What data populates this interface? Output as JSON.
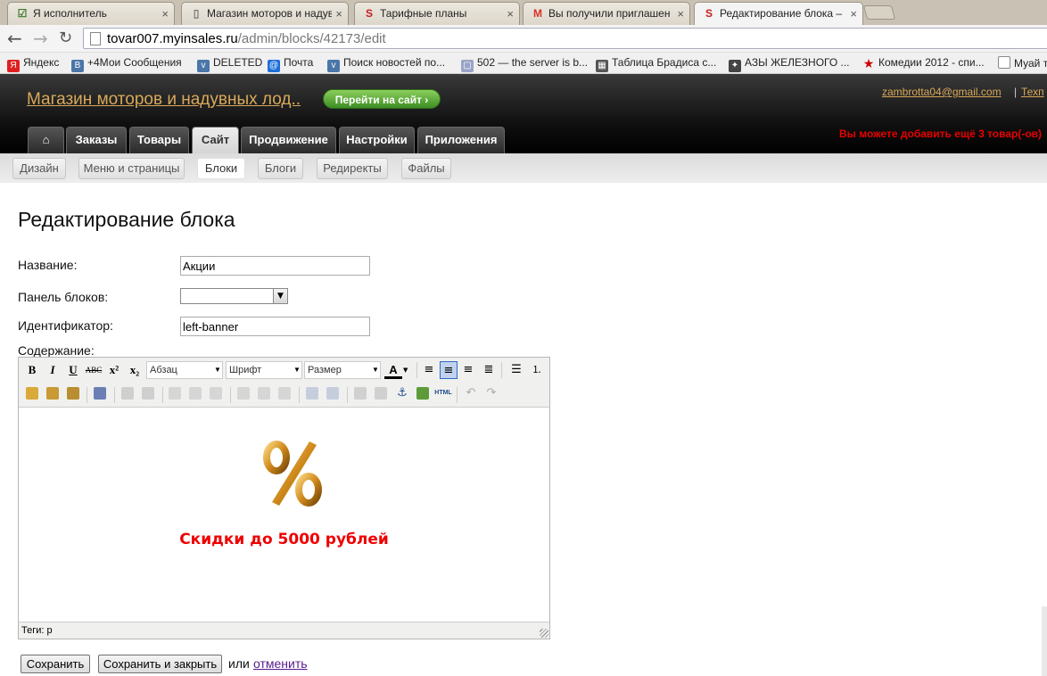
{
  "browser": {
    "tabs": [
      {
        "label": "Я исполнитель",
        "icon": "checkbox-favicon"
      },
      {
        "label": "Магазин моторов и надув",
        "icon": "page-favicon"
      },
      {
        "label": "Тарифные планы",
        "icon": "insales-favicon"
      },
      {
        "label": "Вы получили приглашен",
        "icon": "gmail-favicon"
      },
      {
        "label": "Редактирование блока –",
        "icon": "insales-favicon"
      }
    ],
    "url_host": "tovar007.myinsales.ru",
    "url_path": "/admin/blocks/42173/edit",
    "bookmarks": [
      {
        "label": "Яндекс",
        "color": "#e02020"
      },
      {
        "label": "+4Мои Сообщения",
        "color": "#4a76a8"
      },
      {
        "label": "DELETED",
        "color": "#4a76a8"
      },
      {
        "label": "Почта",
        "color": "#1e6fd9"
      },
      {
        "label": "Поиск новостей по...",
        "color": "#4a76a8"
      },
      {
        "label": "502 — the server is b...",
        "color": "#9aa4c8"
      },
      {
        "label": "Таблица Брадиса с...",
        "color": "#555555"
      },
      {
        "label": "АЗЫ ЖЕЛЕЗНОГО ...",
        "color": "#444444"
      },
      {
        "label": "Комедии 2012 - спи...",
        "color": "#cc0000"
      },
      {
        "label": "Муай т",
        "color": "#888888"
      }
    ]
  },
  "header": {
    "shop_name": "Магазин моторов и надувных лод..",
    "go_site": "Перейти на сайт ›",
    "email": "zambrotta04@gmail.com",
    "separator": "|",
    "tech": "Техп",
    "warning": "Вы можете добавить ещё 3 товар(-ов)",
    "home_icon": "⌂",
    "main_tabs": [
      "Заказы",
      "Товары",
      "Сайт",
      "Продвижение",
      "Настройки",
      "Приложения"
    ],
    "active_tab": "Сайт"
  },
  "subnav": {
    "items": [
      "Дизайн",
      "Меню и страницы",
      "Блоки",
      "Блоги",
      "Редиректы",
      "Файлы"
    ],
    "active": "Блоки"
  },
  "form": {
    "title": "Редактирование блока",
    "name_label": "Название:",
    "name_value": "Акции",
    "panel_label": "Панель блоков:",
    "panel_value": "",
    "ident_label": "Идентификатор:",
    "ident_value": "left-banner",
    "content_label": "Содержание:"
  },
  "editor": {
    "format_dropdowns": [
      "Абзац",
      "Шрифт",
      "Размер"
    ],
    "content_text": "Скидки до 5000 рублей",
    "content_image": "percent-symbol-image",
    "status": "Теги: p",
    "accent": "#316ac5"
  },
  "actions": {
    "save": "Сохранить",
    "save_close": "Сохранить и закрыть",
    "or": "или",
    "cancel": "отменить"
  }
}
